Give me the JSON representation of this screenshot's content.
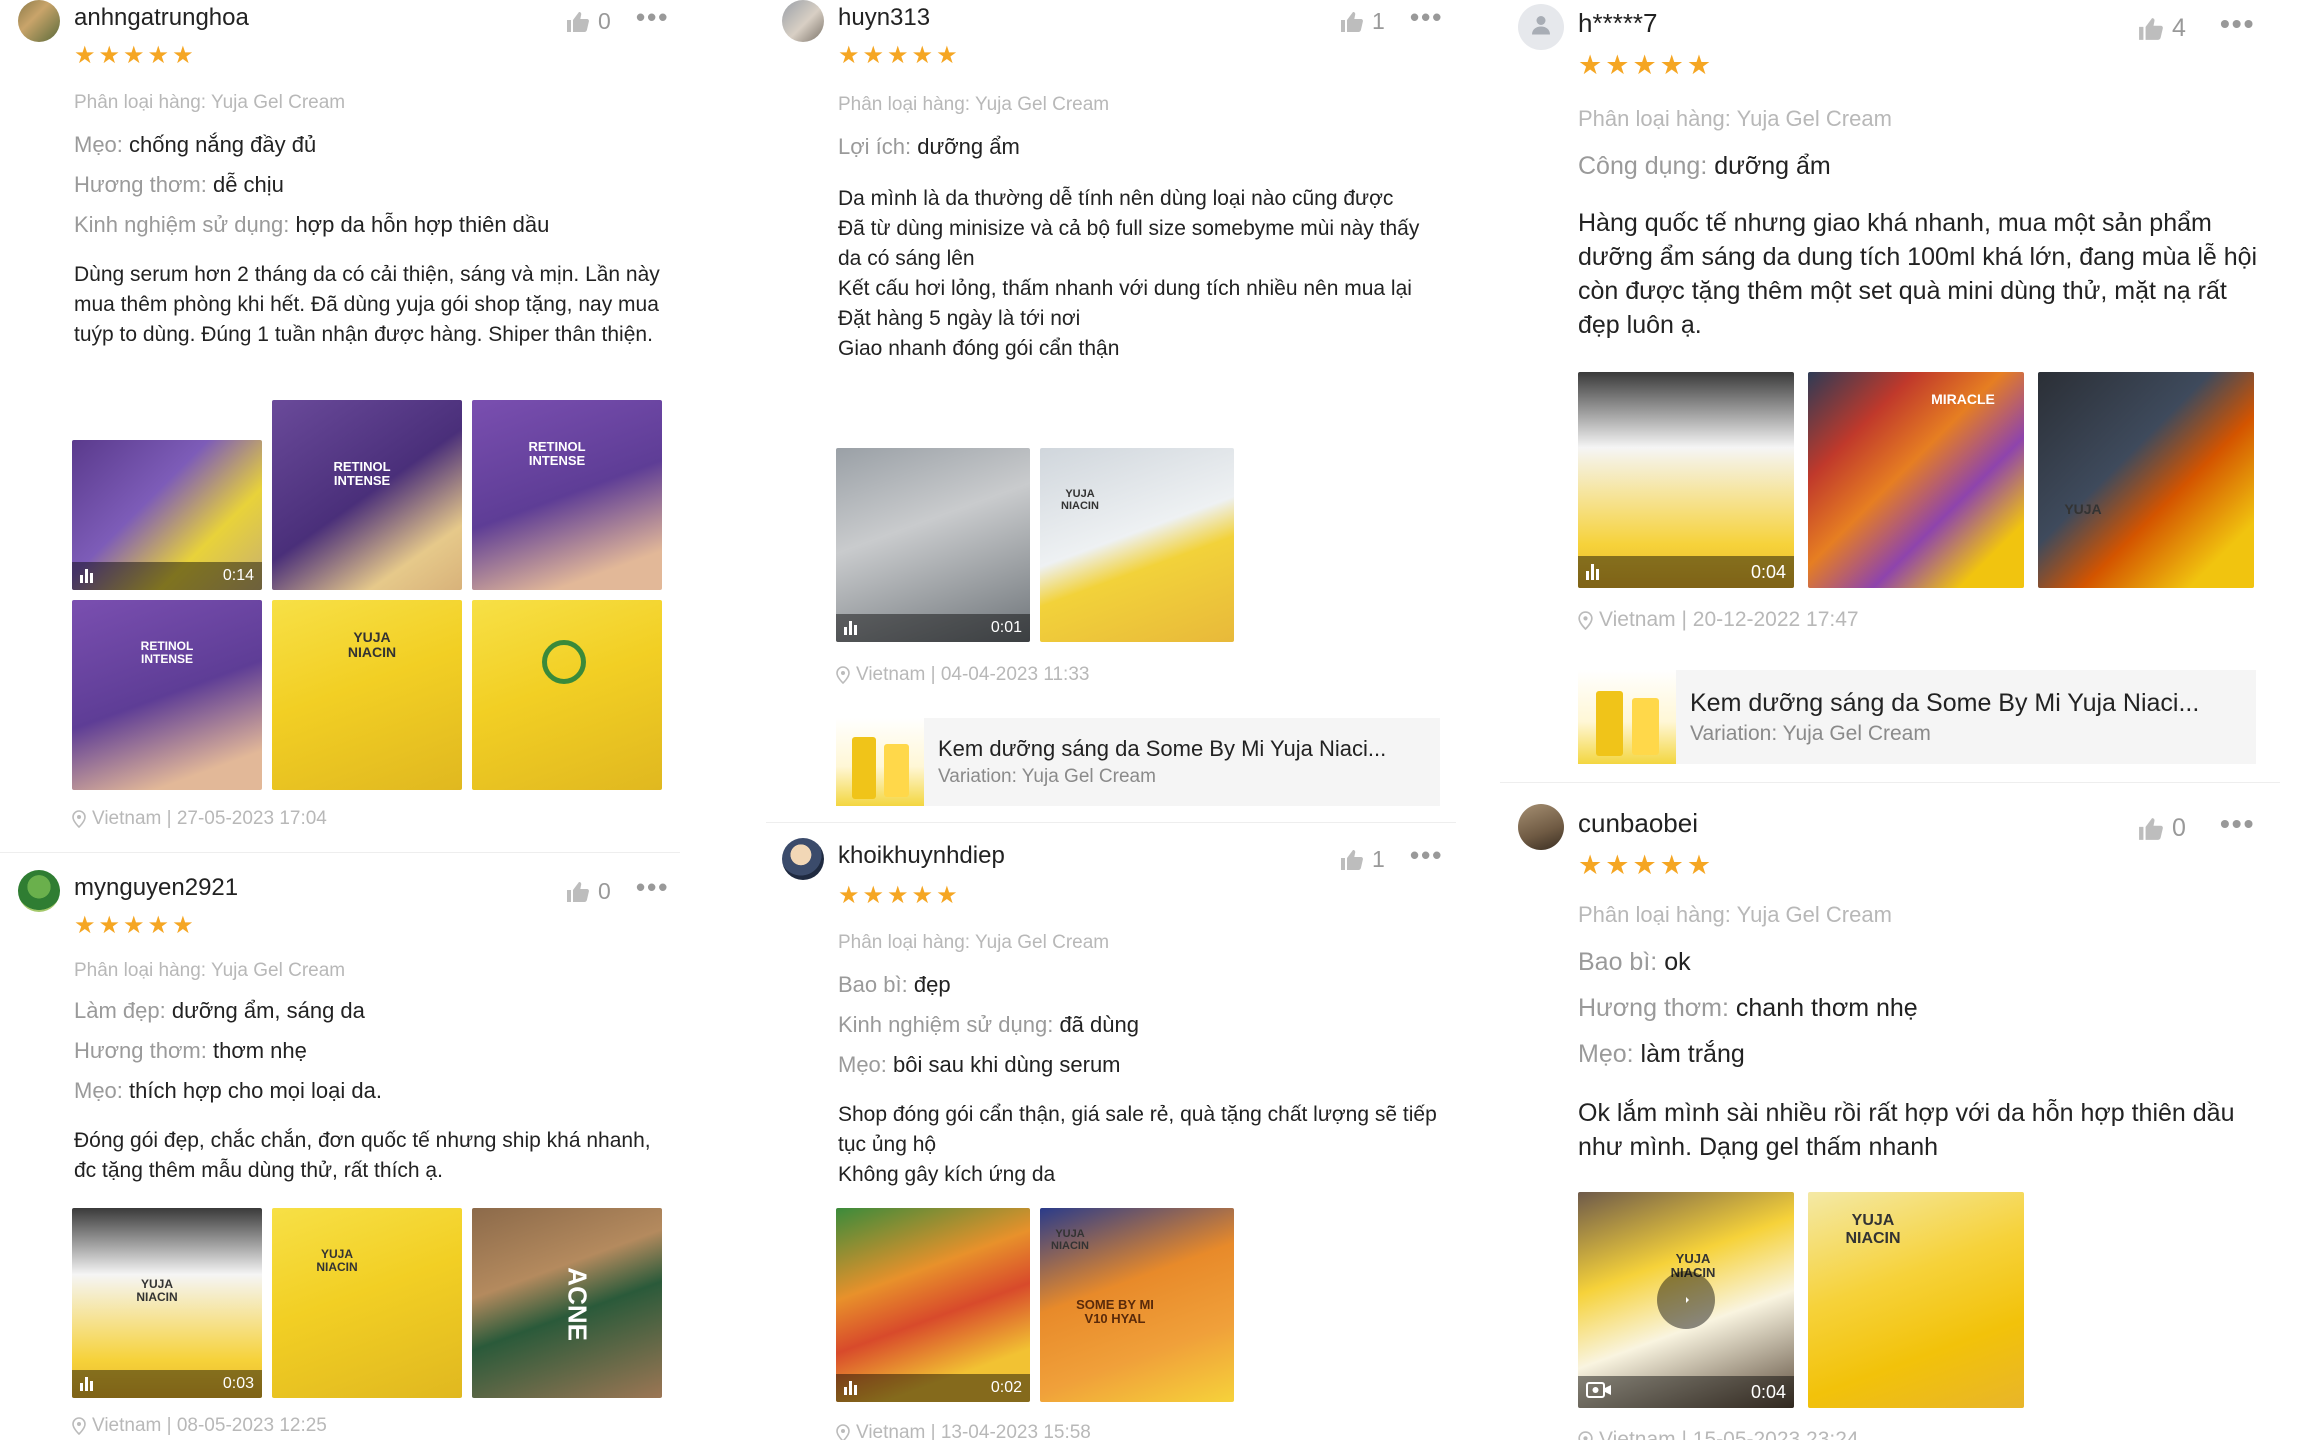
{
  "reviews": [
    {
      "username": "anhngatrunghoa",
      "likes": "0",
      "variation": "Phân loại hàng: Yuja Gel Cream",
      "attributes": [
        {
          "key": "Mẹo:",
          "value": "chống nắng đầy đủ"
        },
        {
          "key": "Hương thơm:",
          "value": "dễ chịu"
        },
        {
          "key": "Kinh nghiệm sử dụng:",
          "value": "hợp da hỗn hợp thiên dầu"
        }
      ],
      "body": "Dùng serum hơn 2 tháng da có cải thiện, sáng và mịn. Lần này mua thêm phòng khi hết. Đã dùng yuja gói shop tặng, nay mua tuýp to dùng. Đúng 1 tuần nhận được hàng. Shiper thân thiện.",
      "video_duration": "0:14",
      "image_labels": [
        "RETINOL INTENSE",
        "RETINOL INTENSE",
        "RETINOL INTENSE",
        "YUJA NIACIN"
      ],
      "meta": "Vietnam | 27-05-2023 17:04"
    },
    {
      "username": "mynguyen2921",
      "likes": "0",
      "variation": "Phân loại hàng: Yuja Gel Cream",
      "attributes": [
        {
          "key": "Làm đẹp:",
          "value": "dưỡng ẩm, sáng da"
        },
        {
          "key": "Hương thơm:",
          "value": "thơm nhẹ"
        },
        {
          "key": "Mẹo:",
          "value": "thích hợp cho mọi loại da."
        }
      ],
      "body": "Đóng gói đẹp, chắc chắn, đơn quốc tế nhưng ship khá nhanh, đc tặng thêm mẫu dùng thử, rất thích ạ.",
      "video_duration": "0:03",
      "image_labels": [
        "YUJA NIACIN",
        "YUJA NIACIN",
        "ACNE"
      ],
      "meta": "Vietnam | 08-05-2023 12:25"
    },
    {
      "username": "huyn313",
      "likes": "1",
      "variation": "Phân loại hàng: Yuja Gel Cream",
      "attributes": [
        {
          "key": "Lợi ích:",
          "value": "dưỡng ẩm"
        }
      ],
      "body_lines": [
        "Da mình là da thường dễ tính nên dùng loại nào cũng được",
        "Đã từ dùng minisize và cả bộ full size somebyme mùi này thấy da có sáng lên",
        "Kết cấu hơi lỏng, thấm nhanh với dung tích nhiều nên mua lại",
        "Đặt hàng 5 ngày là tới nơi",
        "Giao nhanh đóng gói cẩn thận"
      ],
      "video_duration": "0:01",
      "image_labels": [
        "YUJA NIACIN"
      ],
      "meta": "Vietnam | 04-04-2023 11:33",
      "product": {
        "title": "Kem dưỡng sáng da Some By Mi Yuja Niaci...",
        "variation": "Variation: Yuja Gel Cream"
      }
    },
    {
      "username": "khoikhuynhdiep",
      "likes": "1",
      "variation": "Phân loại hàng: Yuja Gel Cream",
      "attributes": [
        {
          "key": "Bao bì:",
          "value": "đẹp"
        },
        {
          "key": "Kinh nghiệm sử dụng:",
          "value": "đã dùng"
        },
        {
          "key": "Mẹo:",
          "value": "bôi sau khi dùng serum"
        }
      ],
      "body_lines": [
        "Shop đóng gói cẩn thận, giá sale rẻ, quà tặng chất lượng sẽ tiếp tục ủng hộ",
        "Không gây kích ứng da"
      ],
      "video_duration": "0:02",
      "image_labels": [
        "YUJA NIACIN",
        "SOME BY MI V10 HYAL"
      ],
      "meta": "Vietnam | 13-04-2023 15:58"
    },
    {
      "username": "h*****7",
      "likes": "4",
      "variation": "Phân loại hàng: Yuja Gel Cream",
      "attributes": [
        {
          "key": "Công dụng:",
          "value": "dưỡng ẩm"
        }
      ],
      "body": "Hàng quốc tế nhưng giao khá nhanh, mua một sản phẩm dưỡng ẩm sáng da dung tích 100ml khá lớn, đang mùa lễ hội còn được tặng thêm một set quà mini dùng thử, mặt nạ rất đẹp luôn ạ.",
      "video_duration": "0:04",
      "image_labels": [
        "MIRACLE",
        "YUJA"
      ],
      "meta": "Vietnam | 20-12-2022 17:47",
      "product": {
        "title": "Kem dưỡng sáng da Some By Mi Yuja Niaci...",
        "variation": "Variation: Yuja Gel Cream"
      }
    },
    {
      "username": "cunbaobei",
      "likes": "0",
      "variation": "Phân loại hàng: Yuja Gel Cream",
      "attributes": [
        {
          "key": "Bao bì:",
          "value": "ok"
        },
        {
          "key": "Hương thơm:",
          "value": "chanh thơm nhẹ"
        },
        {
          "key": "Mẹo:",
          "value": "làm trắng"
        }
      ],
      "body": "Ok lắm mình sài nhiều rồi rất hợp với da hỗn hợp thiên dầu như mình. Dạng gel thấm nhanh",
      "video_duration": "0:04",
      "image_labels": [
        "YUJA NIACIN",
        "YUJA NIACIN"
      ],
      "meta": "Vietnam | 15-05-2023 23:24"
    }
  ],
  "icons": {
    "star": "star-icon",
    "like": "thumbs-up-icon",
    "more": "more-horizontal-icon",
    "location": "location-pin-icon",
    "video": "video-bars-icon",
    "play": "play-icon",
    "camera": "video-camera-icon",
    "default_avatar": "person-icon"
  },
  "colors": {
    "star": "#f5a623",
    "muted": "#9a9a9a",
    "text": "#222222"
  }
}
